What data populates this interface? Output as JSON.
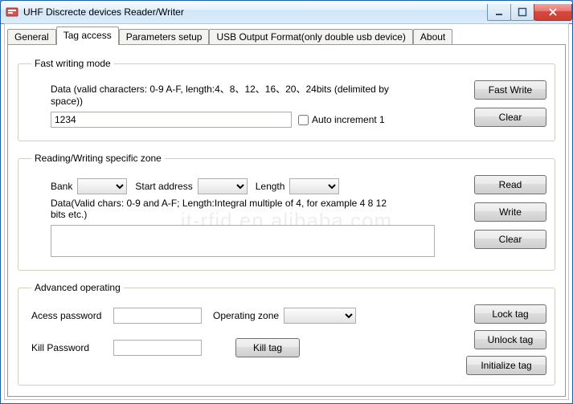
{
  "window": {
    "title": "UHF Discrecte devices Reader/Writer"
  },
  "tabs": {
    "general": "General",
    "tag_access": "Tag access",
    "parameters": "Parameters setup",
    "usb_output": "USB Output Format(only double usb device)",
    "about": "About"
  },
  "fast_write": {
    "legend": "Fast writing mode",
    "hint": "Data (valid characters: 0-9 A-F, length:4、8、12、16、20、24bits (delimited by space))",
    "data_value": "1234",
    "auto_inc_label": "Auto increment 1",
    "auto_inc_checked": false,
    "btn_fast_write": "Fast Write",
    "btn_clear": "Clear"
  },
  "rw_zone": {
    "legend": "Reading/Writing specific zone",
    "bank_label": "Bank",
    "bank_value": "",
    "start_label": "Start address",
    "start_value": "",
    "length_label": "Length",
    "length_value": "",
    "data_hint": "Data(Valid chars: 0-9 and A-F; Length:Integral multiple of 4, for example 4 8 12 bits etc.)",
    "data_value": "",
    "btn_read": "Read",
    "btn_write": "Write",
    "btn_clear": "Clear"
  },
  "advanced": {
    "legend": "Advanced operating",
    "access_pw_label": "Acess password",
    "access_pw_value": "",
    "op_zone_label": "Operating zone",
    "op_zone_value": "",
    "kill_pw_label": "Kill Password",
    "kill_pw_value": "",
    "btn_kill": "Kill tag",
    "btn_lock": "Lock tag",
    "btn_unlock": "Unlock tag",
    "btn_init": "Initialize tag"
  },
  "watermark": "jt-rfid.en.alibaba.com"
}
